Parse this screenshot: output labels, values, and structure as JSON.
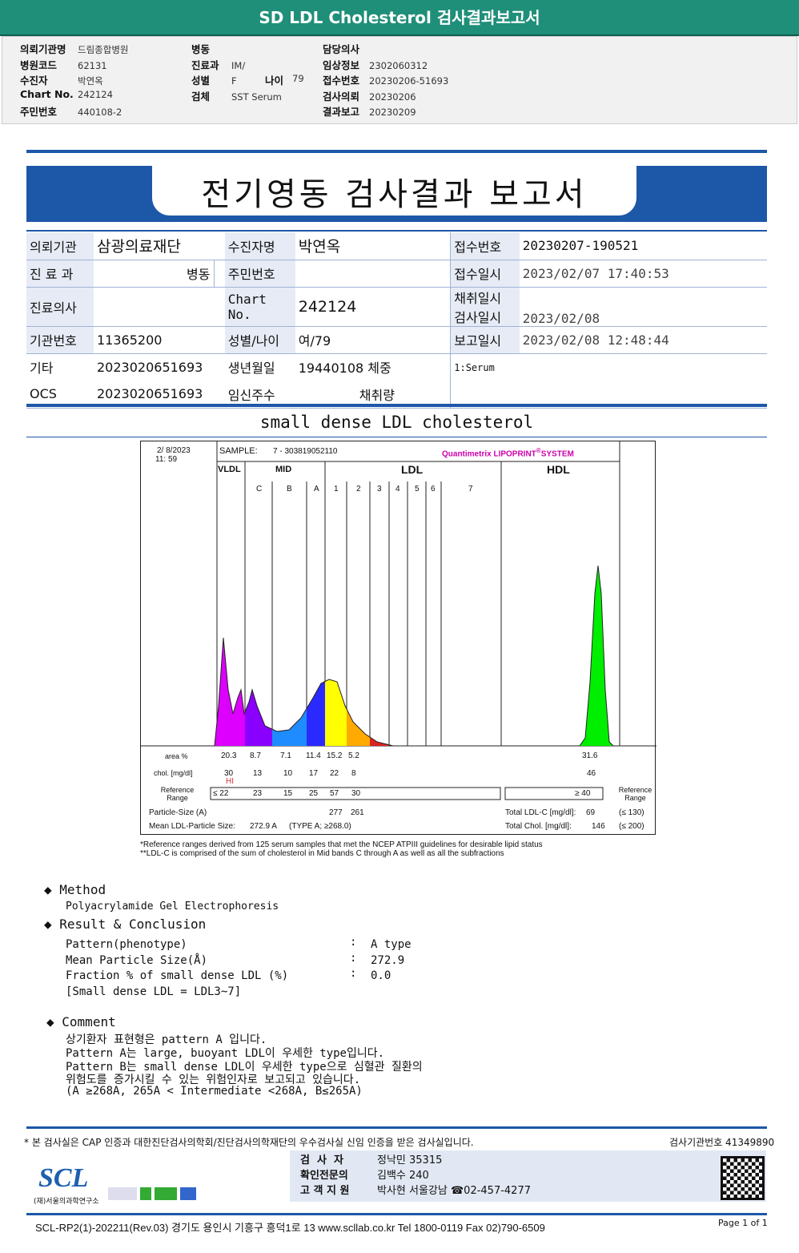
{
  "header": {
    "title": "SD LDL Cholesterol 검사결과보고서"
  },
  "info": {
    "col1": [
      [
        "의뢰기관명",
        "드림종합병원"
      ],
      [
        "병원코드",
        "62131"
      ],
      [
        "수진자",
        "박연옥"
      ],
      [
        "Chart No.",
        "242124"
      ],
      [
        "주민번호",
        "440108-2"
      ]
    ],
    "col2": [
      [
        "병동",
        ""
      ],
      [
        "진료과",
        "IM/"
      ],
      [
        "성별",
        "F"
      ],
      [
        "검체",
        "SST Serum"
      ]
    ],
    "age_label": "나이",
    "age": "79",
    "col3": [
      [
        "담당의사",
        ""
      ],
      [
        "임상정보",
        "2302060312"
      ],
      [
        "접수번호",
        "20230206-51693"
      ],
      [
        "검사의뢰",
        "20230206"
      ],
      [
        "결과보고",
        "20230209"
      ]
    ]
  },
  "report": {
    "title": "전기영동 검사결과 보고서",
    "r1": {
      "l1": "의뢰기관",
      "v1": "삼광의료재단",
      "l2": "수진자명",
      "v2": "박연옥",
      "l3": "접수번호",
      "v3": "20230207-190521"
    },
    "r2": {
      "l1": "진 료 과",
      "v1": "병동",
      "l2": "주민번호",
      "v2": "",
      "l3": "접수일시",
      "v3": "2023/02/07 17:40:53"
    },
    "r2b": {
      "l3": "채취일시",
      "v3": ""
    },
    "r3": {
      "l1": "진료의사",
      "v1": "",
      "l2": "Chart No.",
      "v2": "242124",
      "l3": "검사일시",
      "v3": "2023/02/08"
    },
    "r4": {
      "l1": "기관번호",
      "v1": "11365200",
      "l2": "성별/나이",
      "v2": "여/79",
      "l3": "보고일시",
      "v3": "2023/02/08 12:48:44"
    },
    "r5": {
      "l1": "기타",
      "v1": "2023020651693",
      "l2": "생년월일",
      "v2": "19440108 체중",
      "v3": "1:Serum"
    },
    "r6": {
      "l1": "OCS",
      "v1": "2023020651693",
      "l2": "임신주수",
      "v2": "채취량"
    }
  },
  "section_title": "small dense LDL cholesterol",
  "chart": {
    "date": "2/ 8/2023",
    "time": "11: 59",
    "sample_label": "SAMPLE:",
    "sample": "7 - 303819052110",
    "brand": "Quantimetrix LIPOPRINT",
    "brand2": "SYSTEM",
    "groups": [
      "VLDL",
      "MID",
      "LDL",
      "HDL"
    ],
    "bands": [
      "C",
      "B",
      "A",
      "1",
      "2",
      "3",
      "4",
      "5",
      "6",
      "7"
    ],
    "colors": {
      "vldl": "#dd00ff",
      "c": "#8a00ff",
      "b": "#1e8cff",
      "a": "#2a2aff",
      "l1": "#ffff00",
      "l2": "#ffaa00",
      "l3": "#dd2222",
      "l4": "#222222",
      "hdl": "#00ee00"
    },
    "area_label": "area %",
    "area": [
      "20.3",
      "8.7",
      "7.1",
      "11.4",
      "15.2",
      "5.2"
    ],
    "hdl_area": "31.6",
    "chol_label": "chol. [mg/dl]",
    "chol": [
      "30",
      "13",
      "10",
      "17",
      "22",
      "8"
    ],
    "hdl_chol": "46",
    "hi": "HI",
    "ref_label": "Reference Range",
    "ref": [
      "≤ 22",
      "23",
      "15",
      "25",
      "57",
      "30"
    ],
    "hdl_ref": "≥ 40",
    "ps_label": "Particle-Size (A)",
    "ps": [
      "277",
      "261"
    ],
    "mean_label": "Mean LDL-Particle Size:",
    "mean": "272.9 A",
    "type": "(TYPE A; ≥268.0)",
    "tldl_label": "Total LDL-C [mg/dl]:",
    "tldl": "69",
    "tldl_ref": "(≤ 130)",
    "tchol_label": "Total Chol. [mg/dl]:",
    "tchol": "146",
    "tchol_ref": "(≤ 200)"
  },
  "footnotes": [
    "*Reference ranges derived from 125 serum samples that met the NCEP ATPIII guidelines for desirable lipid status",
    "**LDL-C is comprised of the sum of cholesterol in Mid bands C through A as well as all the subfractions"
  ],
  "method": {
    "title": "Method",
    "text": "Polyacrylamide Gel Electrophoresis"
  },
  "result": {
    "title": "Result & Conclusion",
    "rows": [
      [
        "Pattern(phenotype)",
        "A type"
      ],
      [
        "Mean Particle Size(Å)",
        "272.9"
      ],
      [
        "Fraction % of small dense LDL (%)",
        "0.0"
      ]
    ],
    "note": "[Small dense LDL = LDL3~7]"
  },
  "comment": {
    "title": "Comment",
    "lines": [
      "상기환자 표현형은 pattern A 입니다.",
      "Pattern A는 large, buoyant LDL이 우세한 type입니다.",
      "Pattern B는 small dense LDL이 우세한 type으로 심혈관 질환의",
      "위험도를 증가시킬 수 있는 위험인자로 보고되고 있습니다.",
      "(A ≥268A, 265A < Intermediate <268A, B≤265A)"
    ]
  },
  "footer": {
    "cert": "* 본 검사실은 CAP 인증과 대한진단검사의학회/진단검사의학재단의 우수검사실 신임 인증을 받은 검사실입니다.",
    "inst": "검사기관번호 41349890",
    "sig": [
      [
        "검  사  자",
        "정낙민 35315"
      ],
      [
        "확인전문의",
        "김백수 240"
      ],
      [
        "고 객 지 원",
        "박사현 서울강남 ☎02-457-4277"
      ]
    ],
    "logo": "SCL",
    "logo_sub": "(재)서울의과학연구소",
    "address": "SCL-RP2(1)-202211(Rev.03)  경기도 용인시 기흥구 흥덕1로 13  www.scllab.co.kr   Tel 1800-0119    Fax 02)790-6509",
    "page": "Page 1 of 1"
  }
}
